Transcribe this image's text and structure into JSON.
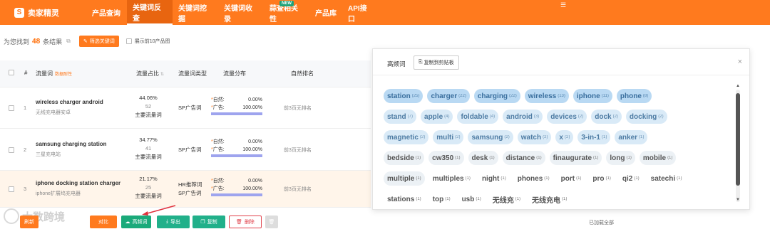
{
  "app": {
    "logo_text": "卖家精灵",
    "logo_mark": "S"
  },
  "nav": [
    {
      "label": "产品查询",
      "width": 58
    },
    {
      "label": "关键词反查",
      "active": true,
      "width": 64
    },
    {
      "label": "关键词挖掘",
      "width": 64
    },
    {
      "label": "关键词收录",
      "width": 64
    },
    {
      "label": "蒜查相关性",
      "new": "NEW",
      "width": 64
    },
    {
      "label": "产品库",
      "width": 46
    },
    {
      "label": "API接口",
      "width": 52
    }
  ],
  "toolbar": {
    "result_prefix": "为您找到",
    "result_count": "48",
    "result_suffix": "条结果",
    "filter_button": "筛选关键词",
    "show_top_label": "展示前10产品图"
  },
  "table": {
    "headers": {
      "keyword": "流量词",
      "keyword_sub": "数据耐性",
      "share": "流量占比",
      "type": "流量词类型",
      "distribution": "流量分布",
      "rank": "自然排名"
    },
    "rows": [
      {
        "index": "1",
        "keyword_en": "wireless charger android",
        "keyword_cn": "无线充电器安卓",
        "share_pct": "44.06%",
        "share_num": "52",
        "share_label": "主要流量词",
        "types": [
          "SP广告词"
        ],
        "natural_label": "自然:",
        "natural_pct": "0.00%",
        "ad_label": "广告:",
        "ad_pct": "100.00%",
        "ad_fill": 1.0,
        "rank": "前3页无排名"
      },
      {
        "index": "2",
        "keyword_en": "samsung charging station",
        "keyword_cn": "三星充电站",
        "share_pct": "34.77%",
        "share_num": "41",
        "share_label": "主要流量词",
        "types": [
          "SP广告词"
        ],
        "natural_label": "自然:",
        "natural_pct": "0.00%",
        "ad_label": "广告:",
        "ad_pct": "100.00%",
        "ad_fill": 1.0,
        "rank": "前3页无排名"
      },
      {
        "index": "3",
        "keyword_en": "iphone docking station charger",
        "keyword_cn": "iphone扩展坞充电器",
        "share_pct": "21.17%",
        "share_num": "25",
        "share_label": "主要流量词",
        "types": [
          "HR推荐词",
          "SP广告词"
        ],
        "natural_label": "自然:",
        "natural_pct": "0.00%",
        "ad_label": "广告:",
        "ad_pct": "100.00%",
        "ad_fill": 1.0,
        "rank": "前3页无排名",
        "highlighted": true
      }
    ]
  },
  "bottom": {
    "refresh": "刷新",
    "compare": "对比",
    "high_freq": "高频词",
    "export": "导出",
    "copy": "复制",
    "delete": "删除",
    "loaded_all": "已加载全部",
    "watermark": "大数跨境"
  },
  "popup": {
    "title": "高频词",
    "copy_button": "复制到剪贴板",
    "close": "×",
    "tag_colors": {
      "high_bg": "#b9d9f3",
      "high_fg": "#3a6f9e",
      "mid_bg": "#d9eaf7",
      "mid_fg": "#4d7ba3",
      "low_bg": "#ecf1f5",
      "low_fg": "#555555"
    },
    "rows": [
      [
        {
          "word": "station",
          "count": "(25)",
          "level": "high"
        },
        {
          "word": "charger",
          "count": "(22)",
          "level": "high"
        },
        {
          "word": "charging",
          "count": "(22)",
          "level": "high"
        },
        {
          "word": "wireless",
          "count": "(13)",
          "level": "high"
        },
        {
          "word": "iphone",
          "count": "(11)",
          "level": "high"
        },
        {
          "word": "phone",
          "count": "(8)",
          "level": "high"
        }
      ],
      [
        {
          "word": "stand",
          "count": "(7)",
          "level": "mid"
        },
        {
          "word": "apple",
          "count": "(4)",
          "level": "mid"
        },
        {
          "word": "foldable",
          "count": "(4)",
          "level": "mid"
        },
        {
          "word": "android",
          "count": "(3)",
          "level": "mid"
        },
        {
          "word": "devices",
          "count": "(2)",
          "level": "mid"
        },
        {
          "word": "dock",
          "count": "(2)",
          "level": "mid"
        },
        {
          "word": "docking",
          "count": "(2)",
          "level": "mid"
        }
      ],
      [
        {
          "word": "magnetic",
          "count": "(2)",
          "level": "mid"
        },
        {
          "word": "multi",
          "count": "(2)",
          "level": "mid"
        },
        {
          "word": "samsung",
          "count": "(2)",
          "level": "mid"
        },
        {
          "word": "watch",
          "count": "(2)",
          "level": "mid"
        },
        {
          "word": "x",
          "count": "(2)",
          "level": "mid"
        },
        {
          "word": "3-in-1",
          "count": "(1)",
          "level": "mid"
        },
        {
          "word": "anker",
          "count": "(1)",
          "level": "mid"
        }
      ],
      [
        {
          "word": "bedside",
          "count": "(1)",
          "level": "low"
        },
        {
          "word": "cw350",
          "count": "(1)",
          "level": "low"
        },
        {
          "word": "desk",
          "count": "(1)",
          "level": "low"
        },
        {
          "word": "distance",
          "count": "(1)",
          "level": "low"
        },
        {
          "word": "finaugurate",
          "count": "(1)",
          "level": "low"
        },
        {
          "word": "long",
          "count": "(1)",
          "level": "low"
        },
        {
          "word": "mobile",
          "count": "(1)",
          "level": "low"
        }
      ],
      [
        {
          "word": "multiple",
          "count": "(1)",
          "level": "low"
        },
        {
          "word": "multiples",
          "count": "(1)",
          "level": "plain"
        },
        {
          "word": "night",
          "count": "(1)",
          "level": "plain"
        },
        {
          "word": "phones",
          "count": "(1)",
          "level": "plain"
        },
        {
          "word": "port",
          "count": "(1)",
          "level": "plain"
        },
        {
          "word": "pro",
          "count": "(1)",
          "level": "plain"
        },
        {
          "word": "qi2",
          "count": "(1)",
          "level": "plain"
        },
        {
          "word": "satechi",
          "count": "(1)",
          "level": "plain"
        }
      ],
      [
        {
          "word": "stations",
          "count": "(1)",
          "level": "plain"
        },
        {
          "word": "top",
          "count": "(1)",
          "level": "plain"
        },
        {
          "word": "usb",
          "count": "(1)",
          "level": "plain"
        },
        {
          "word": "无线充",
          "count": "(1)",
          "level": "plain"
        },
        {
          "word": "无线充电",
          "count": "(1)",
          "level": "plain"
        }
      ]
    ]
  }
}
